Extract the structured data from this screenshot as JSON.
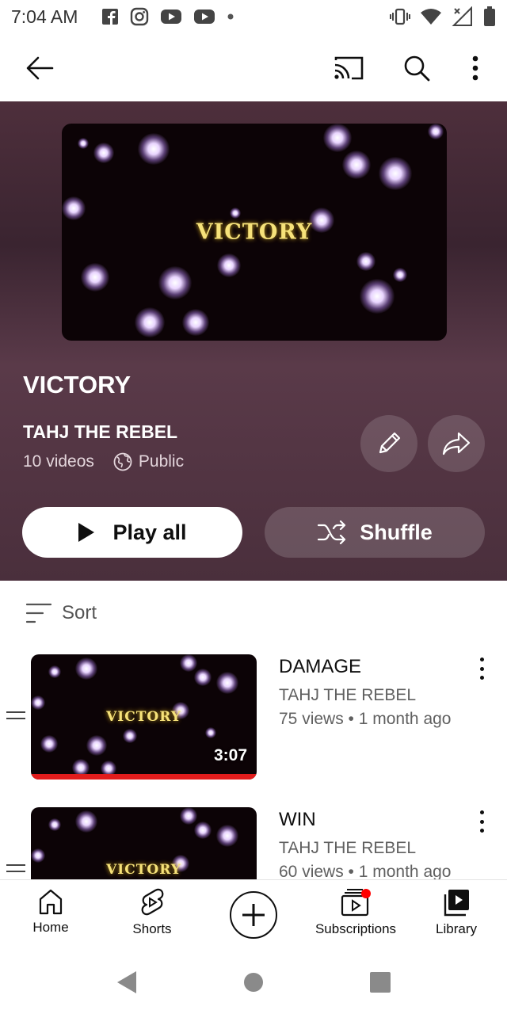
{
  "status_bar": {
    "time": "7:04 AM",
    "left_icons": [
      "facebook-icon",
      "instagram-icon",
      "youtube-icon",
      "youtube-icon",
      "dot-icon"
    ],
    "right_icons": [
      "vibrate-icon",
      "wifi-icon",
      "signal-icon",
      "battery-icon"
    ]
  },
  "top_bar": {
    "icons": [
      "back-arrow-icon",
      "cast-icon",
      "search-icon",
      "more-vert-icon"
    ]
  },
  "playlist": {
    "thumbnail_text": "VICTORY",
    "title": "VICTORY",
    "channel": "TAHJ THE REBEL",
    "video_count": "10 videos",
    "privacy": "Public",
    "play_all_label": "Play all",
    "shuffle_label": "Shuffle",
    "colors": {
      "hero_bg": "#4a2f3c",
      "thumb_text": "#f6e27a",
      "progress": "#e21c1c"
    }
  },
  "sort": {
    "label": "Sort"
  },
  "videos": [
    {
      "title": "DAMAGE",
      "channel": "TAHJ THE REBEL",
      "meta": "75 views • 1 month ago",
      "duration": "3:07",
      "thumbnail_text": "VICTORY",
      "watched_fraction": 1.0
    },
    {
      "title": "WIN",
      "channel": "TAHJ THE REBEL",
      "meta": "60 views • 1 month ago",
      "duration": "",
      "thumbnail_text": "VICTORY"
    }
  ],
  "bottom_nav": {
    "items": [
      {
        "label": "Home",
        "icon": "home-icon"
      },
      {
        "label": "Shorts",
        "icon": "shorts-icon"
      },
      {
        "label": "",
        "icon": "create-plus-icon"
      },
      {
        "label": "Subscriptions",
        "icon": "subscriptions-icon"
      },
      {
        "label": "Library",
        "icon": "library-icon"
      }
    ]
  },
  "system_nav": {
    "icons": [
      "back-triangle-icon",
      "home-circle-icon",
      "recents-square-icon"
    ]
  }
}
